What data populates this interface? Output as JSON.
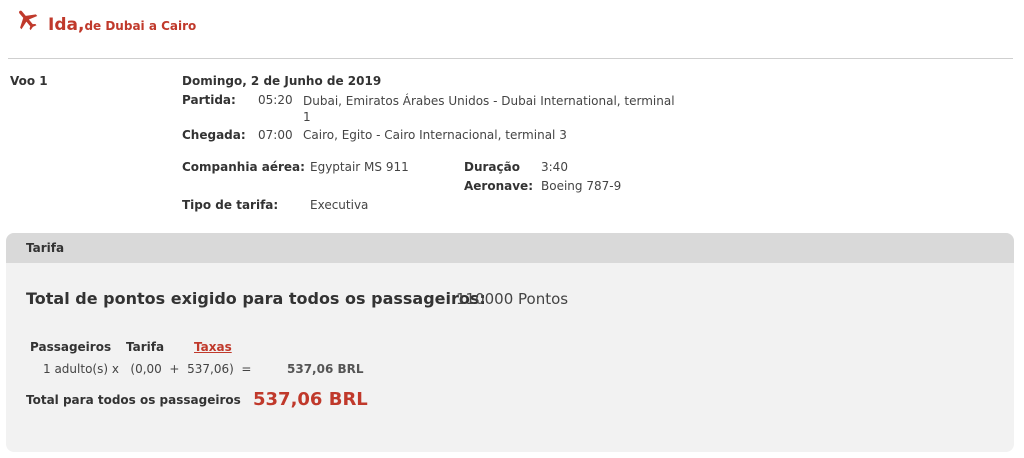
{
  "header": {
    "title": "Ida,",
    "route": "de Dubai a Cairo",
    "icon": "airplane-icon",
    "accent_color": "#c0392b"
  },
  "flight": {
    "label": "Voo 1",
    "date": "Domingo, 2 de Junho de 2019",
    "departure": {
      "label": "Partida:",
      "time": "05:20",
      "place": "Dubai, Emiratos Árabes Unidos - Dubai International, terminal 1"
    },
    "arrival": {
      "label": "Chegada:",
      "time": "07:00",
      "place": "Cairo, Egito - Cairo Internacional, terminal 3"
    },
    "airline": {
      "label": "Companhia aérea:",
      "value": "Egyptair MS 911"
    },
    "duration": {
      "label": "Duração",
      "value": "3:40"
    },
    "aircraft": {
      "label": "Aeronave:",
      "value": "Boeing 787-9"
    },
    "fare_type": {
      "label": "Tipo de tarifa:",
      "value": "Executiva"
    }
  },
  "fare": {
    "section_label": "Tarifa",
    "total_points_label": "Total de pontos exigido para todos os passageiros:",
    "total_points_value": "110000 Pontos",
    "columns": {
      "passengers": "Passageiros",
      "fare": "Tarifa",
      "taxes": "Taxas"
    },
    "row": {
      "calc": "1 adulto(s) x   (0,00  +  537,06)  =",
      "subtotal": "537,06 BRL"
    },
    "grand_total_label": "Total para todos os passageiros",
    "grand_total_value": "537,06 BRL"
  }
}
